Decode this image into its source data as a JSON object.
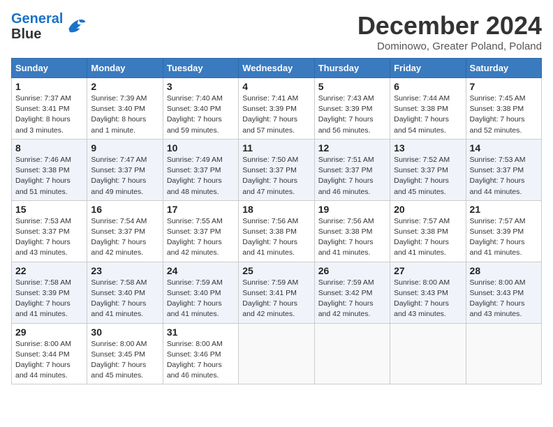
{
  "header": {
    "logo_line1": "General",
    "logo_line2": "Blue",
    "month_title": "December 2024",
    "location": "Dominowo, Greater Poland, Poland"
  },
  "days_of_week": [
    "Sunday",
    "Monday",
    "Tuesday",
    "Wednesday",
    "Thursday",
    "Friday",
    "Saturday"
  ],
  "weeks": [
    [
      {
        "day": "1",
        "sunrise": "7:37 AM",
        "sunset": "3:41 PM",
        "daylight": "8 hours and 3 minutes."
      },
      {
        "day": "2",
        "sunrise": "7:39 AM",
        "sunset": "3:40 PM",
        "daylight": "8 hours and 1 minute."
      },
      {
        "day": "3",
        "sunrise": "7:40 AM",
        "sunset": "3:40 PM",
        "daylight": "7 hours and 59 minutes."
      },
      {
        "day": "4",
        "sunrise": "7:41 AM",
        "sunset": "3:39 PM",
        "daylight": "7 hours and 57 minutes."
      },
      {
        "day": "5",
        "sunrise": "7:43 AM",
        "sunset": "3:39 PM",
        "daylight": "7 hours and 56 minutes."
      },
      {
        "day": "6",
        "sunrise": "7:44 AM",
        "sunset": "3:38 PM",
        "daylight": "7 hours and 54 minutes."
      },
      {
        "day": "7",
        "sunrise": "7:45 AM",
        "sunset": "3:38 PM",
        "daylight": "7 hours and 52 minutes."
      }
    ],
    [
      {
        "day": "8",
        "sunrise": "7:46 AM",
        "sunset": "3:38 PM",
        "daylight": "7 hours and 51 minutes."
      },
      {
        "day": "9",
        "sunrise": "7:47 AM",
        "sunset": "3:37 PM",
        "daylight": "7 hours and 49 minutes."
      },
      {
        "day": "10",
        "sunrise": "7:49 AM",
        "sunset": "3:37 PM",
        "daylight": "7 hours and 48 minutes."
      },
      {
        "day": "11",
        "sunrise": "7:50 AM",
        "sunset": "3:37 PM",
        "daylight": "7 hours and 47 minutes."
      },
      {
        "day": "12",
        "sunrise": "7:51 AM",
        "sunset": "3:37 PM",
        "daylight": "7 hours and 46 minutes."
      },
      {
        "day": "13",
        "sunrise": "7:52 AM",
        "sunset": "3:37 PM",
        "daylight": "7 hours and 45 minutes."
      },
      {
        "day": "14",
        "sunrise": "7:53 AM",
        "sunset": "3:37 PM",
        "daylight": "7 hours and 44 minutes."
      }
    ],
    [
      {
        "day": "15",
        "sunrise": "7:53 AM",
        "sunset": "3:37 PM",
        "daylight": "7 hours and 43 minutes."
      },
      {
        "day": "16",
        "sunrise": "7:54 AM",
        "sunset": "3:37 PM",
        "daylight": "7 hours and 42 minutes."
      },
      {
        "day": "17",
        "sunrise": "7:55 AM",
        "sunset": "3:37 PM",
        "daylight": "7 hours and 42 minutes."
      },
      {
        "day": "18",
        "sunrise": "7:56 AM",
        "sunset": "3:38 PM",
        "daylight": "7 hours and 41 minutes."
      },
      {
        "day": "19",
        "sunrise": "7:56 AM",
        "sunset": "3:38 PM",
        "daylight": "7 hours and 41 minutes."
      },
      {
        "day": "20",
        "sunrise": "7:57 AM",
        "sunset": "3:38 PM",
        "daylight": "7 hours and 41 minutes."
      },
      {
        "day": "21",
        "sunrise": "7:57 AM",
        "sunset": "3:39 PM",
        "daylight": "7 hours and 41 minutes."
      }
    ],
    [
      {
        "day": "22",
        "sunrise": "7:58 AM",
        "sunset": "3:39 PM",
        "daylight": "7 hours and 41 minutes."
      },
      {
        "day": "23",
        "sunrise": "7:58 AM",
        "sunset": "3:40 PM",
        "daylight": "7 hours and 41 minutes."
      },
      {
        "day": "24",
        "sunrise": "7:59 AM",
        "sunset": "3:40 PM",
        "daylight": "7 hours and 41 minutes."
      },
      {
        "day": "25",
        "sunrise": "7:59 AM",
        "sunset": "3:41 PM",
        "daylight": "7 hours and 42 minutes."
      },
      {
        "day": "26",
        "sunrise": "7:59 AM",
        "sunset": "3:42 PM",
        "daylight": "7 hours and 42 minutes."
      },
      {
        "day": "27",
        "sunrise": "8:00 AM",
        "sunset": "3:43 PM",
        "daylight": "7 hours and 43 minutes."
      },
      {
        "day": "28",
        "sunrise": "8:00 AM",
        "sunset": "3:43 PM",
        "daylight": "7 hours and 43 minutes."
      }
    ],
    [
      {
        "day": "29",
        "sunrise": "8:00 AM",
        "sunset": "3:44 PM",
        "daylight": "7 hours and 44 minutes."
      },
      {
        "day": "30",
        "sunrise": "8:00 AM",
        "sunset": "3:45 PM",
        "daylight": "7 hours and 45 minutes."
      },
      {
        "day": "31",
        "sunrise": "8:00 AM",
        "sunset": "3:46 PM",
        "daylight": "7 hours and 46 minutes."
      },
      null,
      null,
      null,
      null
    ]
  ],
  "labels": {
    "sunrise": "Sunrise:",
    "sunset": "Sunset:",
    "daylight": "Daylight:"
  }
}
